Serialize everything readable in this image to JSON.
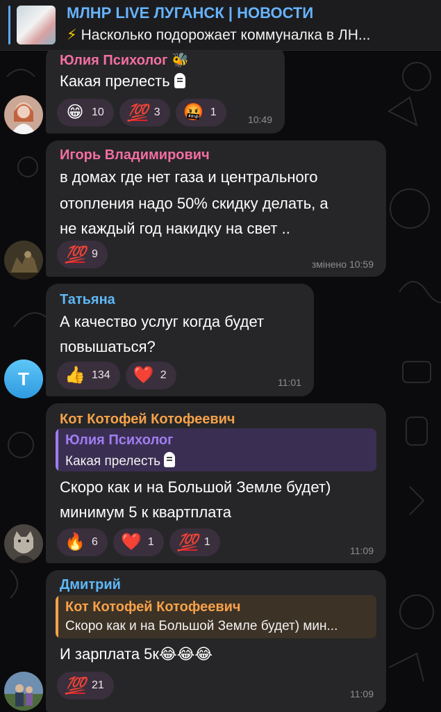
{
  "pinned": {
    "channel_title": "МЛНР LIVE ЛУГАНСК | НОВОСТИ",
    "bolt": "⚡",
    "preview": "Насколько подорожает коммуналка в ЛН..."
  },
  "messages": [
    {
      "author": "Юлия Психолог",
      "author_badge": "🐝",
      "author_color": "#f36fa0",
      "lines": [
        "Какая прелесть"
      ],
      "reactions": [
        {
          "emoji": "😁",
          "count": "10"
        },
        {
          "emoji": "💯",
          "count": "3"
        },
        {
          "emoji": "🤬",
          "count": "1"
        }
      ],
      "time": "10:49"
    },
    {
      "author": "Игорь Владимирович",
      "author_color": "#f36fa0",
      "lines": [
        "в домах где нет газа и центрального",
        "отопления надо 50% скидку делать, а",
        "не каждый год накидку на свет .."
      ],
      "reactions": [
        {
          "emoji": "💯",
          "count": "9"
        }
      ],
      "time": "змінено 10:59"
    },
    {
      "author": "Татьяна",
      "author_color": "#5fb8f7",
      "avatar_letter": "Т",
      "lines": [
        "А качество услуг когда будет",
        "повышаться?"
      ],
      "reactions": [
        {
          "emoji": "👍",
          "count": "134"
        },
        {
          "emoji": "❤️",
          "count": "2"
        }
      ],
      "time": "11:01"
    },
    {
      "author": "Кот Котофей Котофеевич",
      "author_color": "#f7a24a",
      "quote": {
        "name": "Юлия Психолог",
        "text": "Какая прелесть",
        "color": "#a07df0"
      },
      "lines": [
        "Скоро как и на Большой Земле будет)",
        "минимум 5 к квартплата"
      ],
      "reactions": [
        {
          "emoji": "🔥",
          "count": "6"
        },
        {
          "emoji": "❤️",
          "count": "1"
        },
        {
          "emoji": "💯",
          "count": "1"
        }
      ],
      "time": "11:09"
    },
    {
      "author": "Дмитрий",
      "author_color": "#5fb8f7",
      "quote": {
        "name": "Кот Котофей Котофеевич",
        "text": "Скоро как и на Большой Земле будет) мин...",
        "color": "#f7a24a"
      },
      "lines": [
        "И зарплата 5к😂😂😂"
      ],
      "reactions": [
        {
          "emoji": "💯",
          "count": "21"
        }
      ],
      "time": "11:09"
    }
  ]
}
